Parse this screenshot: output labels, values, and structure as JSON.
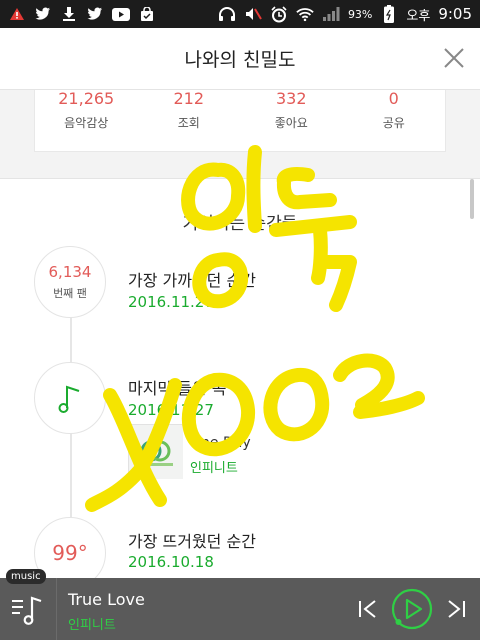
{
  "status_bar": {
    "battery": "93%",
    "ampm": "오후",
    "time": "9:05",
    "icons_left": [
      "warning-icon",
      "twitter-icon",
      "download-icon",
      "twitter-icon",
      "youtube-icon",
      "bag-icon"
    ],
    "icons_right": [
      "headphones-icon",
      "mute-icon",
      "alarm-icon",
      "wifi-icon",
      "signal-icon",
      "battery-icon"
    ]
  },
  "header": {
    "title": "나와의 친밀도"
  },
  "stats": [
    {
      "value": "21,265",
      "label": "음악감상"
    },
    {
      "value": "212",
      "label": "조회"
    },
    {
      "value": "332",
      "label": "좋아요"
    },
    {
      "value": "0",
      "label": "공유"
    }
  ],
  "timeline": {
    "title": "기억되는 순간들",
    "items": [
      {
        "node_big": "6,134",
        "node_small": "번째 팬",
        "title": "가장 가까웠던 순간",
        "date": "2016.11.27"
      },
      {
        "node_icon": "music-note-icon",
        "title": "마지막 들은 곡",
        "date": "2016.11.27",
        "album_title": "One Day",
        "album_artist": "인피니트"
      },
      {
        "node_big": "99°",
        "title": "가장 뜨거웠던 순간",
        "date": "2016.10.18"
      }
    ]
  },
  "player": {
    "tag": "music",
    "song": "True Love",
    "artist": "인피니트"
  },
  "colors": {
    "accent_red": "#e25b58",
    "accent_green": "#1aab2e",
    "scribble_yellow": "#f5e400"
  }
}
